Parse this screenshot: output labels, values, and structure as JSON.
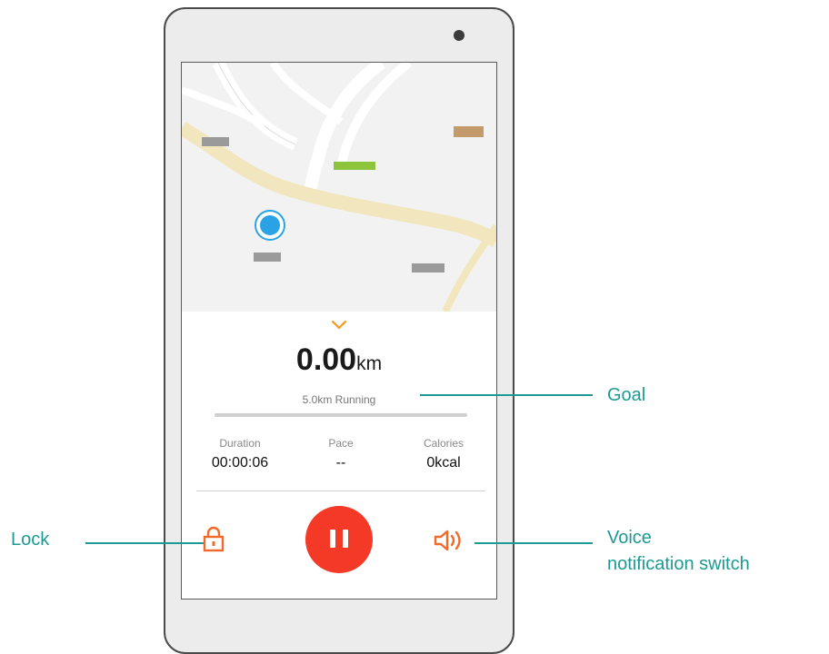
{
  "run": {
    "distance_value": "0.00",
    "distance_unit": "km",
    "goal": "5.0km Running",
    "goal_progress": 0,
    "stats": [
      {
        "label": "Duration",
        "value": "00:00:06"
      },
      {
        "label": "Pace",
        "value": "--"
      },
      {
        "label": "Calories",
        "value": "0kcal"
      }
    ]
  },
  "callouts": {
    "goal": "Goal",
    "lock": "Lock",
    "voice_line1": "Voice",
    "voice_line2": "notification switch"
  },
  "icons": {
    "collapse": "chevron-down-icon",
    "lock": "lock-icon",
    "pause": "pause-icon",
    "voice": "speaker-icon",
    "location": "location-dot-icon"
  },
  "colors": {
    "accent": "#f43a26",
    "icon_orange": "#f26a2a",
    "chevron": "#f39b1d",
    "callout": "#1d9a93",
    "location_dot": "#29a3e6"
  }
}
